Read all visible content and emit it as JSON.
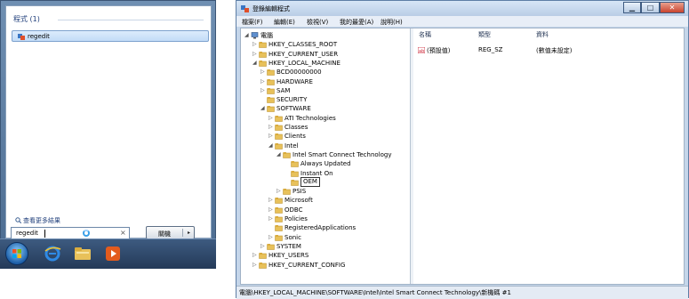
{
  "start_menu": {
    "programs_header": "程式 (1)",
    "result_label": "regedit",
    "see_more": "查看更多結果",
    "search_value": "regedit",
    "clear_symbol": "×",
    "shutdown_label": "關機",
    "shutdown_arrow": "▸"
  },
  "taskbar": {
    "items": [
      "start-orb",
      "internet-explorer",
      "windows-explorer",
      "media-player"
    ]
  },
  "regedit": {
    "title": "登錄編輯程式",
    "window_buttons": {
      "minimize": "▁",
      "maximize": "□",
      "close": "✕"
    },
    "menu": [
      "檔案(F)",
      "編輯(E)",
      "檢視(V)",
      "我的最愛(A)",
      "說明(H)"
    ],
    "tree": [
      {
        "label": "電腦",
        "expander": "◢"
      },
      {
        "label": "HKEY_CLASSES_ROOT",
        "expander": "▷"
      },
      {
        "label": "HKEY_CURRENT_USER",
        "expander": "▷"
      },
      {
        "label": "HKEY_LOCAL_MACHINE",
        "expander": "◢"
      },
      {
        "label": "BCD00000000",
        "expander": "▷"
      },
      {
        "label": "HARDWARE",
        "expander": "▷"
      },
      {
        "label": "SAM",
        "expander": "▷"
      },
      {
        "label": "SECURITY",
        "expander": ""
      },
      {
        "label": "SOFTWARE",
        "expander": "◢"
      },
      {
        "label": "ATI Technologies",
        "expander": "▷"
      },
      {
        "label": "Classes",
        "expander": "▷"
      },
      {
        "label": "Clients",
        "expander": "▷"
      },
      {
        "label": "Intel",
        "expander": "◢"
      },
      {
        "label": "Intel Smart Connect Technology",
        "expander": "◢"
      },
      {
        "label": "Always Updated",
        "expander": ""
      },
      {
        "label": "Instant On",
        "expander": ""
      },
      {
        "label": "OEM",
        "expander": ""
      },
      {
        "label": "PSIS",
        "expander": "▷"
      },
      {
        "label": "Microsoft",
        "expander": "▷"
      },
      {
        "label": "ODBC",
        "expander": "▷"
      },
      {
        "label": "Policies",
        "expander": "▷"
      },
      {
        "label": "RegisteredApplications",
        "expander": ""
      },
      {
        "label": "Sonic",
        "expander": "▷"
      },
      {
        "label": "SYSTEM",
        "expander": "▷"
      },
      {
        "label": "HKEY_USERS",
        "expander": "▷"
      },
      {
        "label": "HKEY_CURRENT_CONFIG",
        "expander": "▷"
      }
    ],
    "columns": [
      "名稱",
      "類型",
      "資料"
    ],
    "rows": [
      {
        "name": "(預設值)",
        "type": "REG_SZ",
        "data": "(數值未設定)"
      }
    ],
    "status": "電腦\\HKEY_LOCAL_MACHINE\\SOFTWARE\\Intel\\Intel Smart Connect Technology\\新機碼 #1"
  },
  "colors": {
    "folder": "#e8c15a",
    "selection": "#cfe3fa",
    "close": "#c9432e"
  }
}
